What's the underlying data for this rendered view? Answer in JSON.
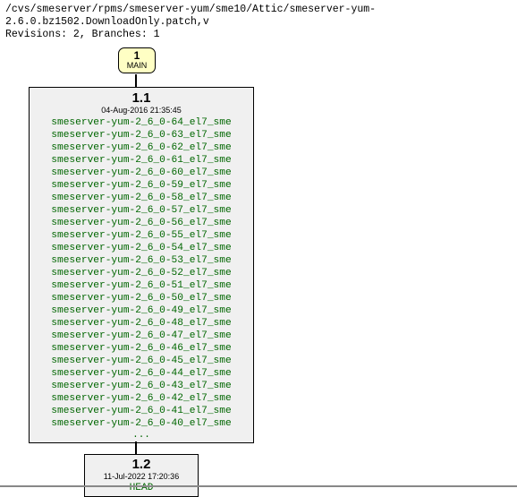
{
  "header": {
    "path": "/cvs/smeserver/rpms/smeserver-yum/sme10/Attic/smeserver-yum-2.6.0.bz1502.DownloadOnly.patch,v",
    "revisions_line": "Revisions: 2, Branches: 1"
  },
  "branch": {
    "num": "1",
    "name": "MAIN"
  },
  "rev11": {
    "num": "1.1",
    "date": "04-Aug-2016 21:35:45",
    "tags": [
      "smeserver-yum-2_6_0-64_el7_sme",
      "smeserver-yum-2_6_0-63_el7_sme",
      "smeserver-yum-2_6_0-62_el7_sme",
      "smeserver-yum-2_6_0-61_el7_sme",
      "smeserver-yum-2_6_0-60_el7_sme",
      "smeserver-yum-2_6_0-59_el7_sme",
      "smeserver-yum-2_6_0-58_el7_sme",
      "smeserver-yum-2_6_0-57_el7_sme",
      "smeserver-yum-2_6_0-56_el7_sme",
      "smeserver-yum-2_6_0-55_el7_sme",
      "smeserver-yum-2_6_0-54_el7_sme",
      "smeserver-yum-2_6_0-53_el7_sme",
      "smeserver-yum-2_6_0-52_el7_sme",
      "smeserver-yum-2_6_0-51_el7_sme",
      "smeserver-yum-2_6_0-50_el7_sme",
      "smeserver-yum-2_6_0-49_el7_sme",
      "smeserver-yum-2_6_0-48_el7_sme",
      "smeserver-yum-2_6_0-47_el7_sme",
      "smeserver-yum-2_6_0-46_el7_sme",
      "smeserver-yum-2_6_0-45_el7_sme",
      "smeserver-yum-2_6_0-44_el7_sme",
      "smeserver-yum-2_6_0-43_el7_sme",
      "smeserver-yum-2_6_0-42_el7_sme",
      "smeserver-yum-2_6_0-41_el7_sme",
      "smeserver-yum-2_6_0-40_el7_sme"
    ],
    "ellipsis": "..."
  },
  "rev12": {
    "num": "1.2",
    "date": "11-Jul-2022 17:20:36",
    "head": "HEAD"
  }
}
